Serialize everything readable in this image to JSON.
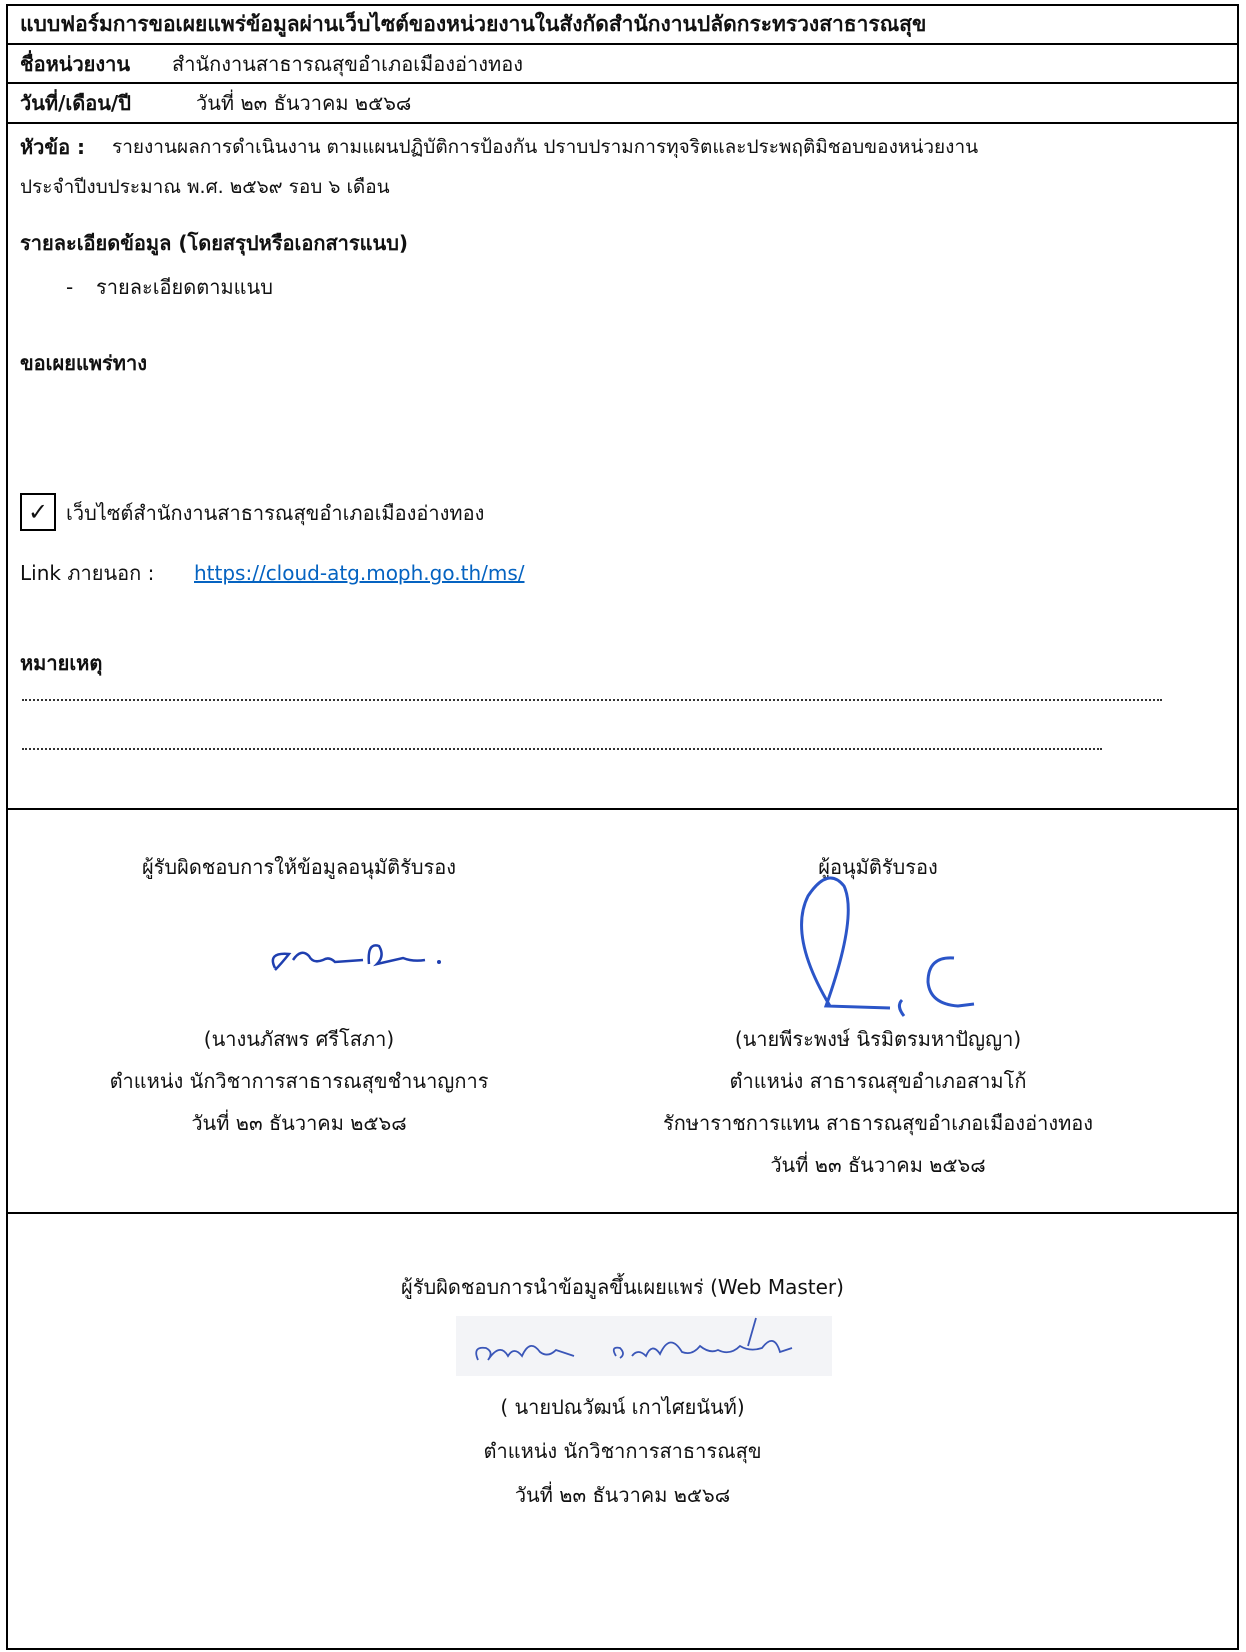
{
  "title": "แบบฟอร์มการขอเผยแพร่ข้อมูลผ่านเว็บไซต์ของหน่วยงานในสังกัดสำนักงานปลัดกระทรวงสาธารณสุข",
  "unit": {
    "label": "ชื่อหน่วยงาน",
    "value": "สำนักงานสาธารณสุขอำเภอเมืองอ่างทอง"
  },
  "date": {
    "label": "วันที่/เดือน/ปี",
    "value": "วันที่ ๒๓  ธันวาคม ๒๕๖๘"
  },
  "topic": {
    "label": "หัวข้อ :",
    "line1": "รายงานผลการดำเนินงาน ตามแผนปฏิบัติการป้องกัน ปราบปรามการทุจริตและประพฤติมิชอบของหน่วยงาน",
    "line2": "ประจำปีงบประมาณ พ.ศ. ๒๕๖๙ รอบ ๖ เดือน"
  },
  "details": {
    "heading": "รายละเอียดข้อมูล (โดยสรุปหรือเอกสารแนบ)",
    "bullet": "-",
    "item": "รายละเอียดตามแนบ"
  },
  "publish": {
    "heading": "ขอเผยแพร่ทาง",
    "check_mark": "✓",
    "option": "เว็บไซต์สำนักงานสาธารณสุขอำเภอเมืองอ่างทอง",
    "link_label": "Link ภายนอก :",
    "link_url": "https://cloud-atg.moph.go.th/ms/"
  },
  "remarks": {
    "heading": "หมายเหตุ"
  },
  "signers": {
    "left": {
      "role": "ผู้รับผิดชอบการให้ข้อมูลอนุมัติรับรอง",
      "name": "(นางนภัสพร  ศรีโสภา)",
      "position": "ตำแหน่ง นักวิชาการสาธารณสุขชำนาญการ",
      "date": "วันที่ ๒๓  ธันวาคม ๒๕๖๘"
    },
    "right": {
      "role": "ผู้อนุมัติรับรอง",
      "name": "(นายพีระพงษ์  นิรมิตรมหาปัญญา)",
      "position": "ตำแหน่ง  สาธารณสุขอำเภอสามโก้",
      "acting": "รักษาราชการแทน สาธารณสุขอำเภอเมืองอ่างทอง",
      "date": "วันที่ ๒๓  ธันวาคม ๒๕๖๘"
    },
    "webmaster": {
      "role": "ผู้รับผิดชอบการนำข้อมูลขึ้นเผยแพร่ (Web Master)",
      "name": "( นายปณวัฒน์ เกาไศยนันท์)",
      "position": "ตำแหน่ง นักวิชาการสาธารณสุข",
      "date": "วันที่ ๒๓  ธันวาคม ๒๕๖๘"
    }
  },
  "colors": {
    "link": "#0563c1",
    "signature_blue": "#1f3fb0"
  }
}
